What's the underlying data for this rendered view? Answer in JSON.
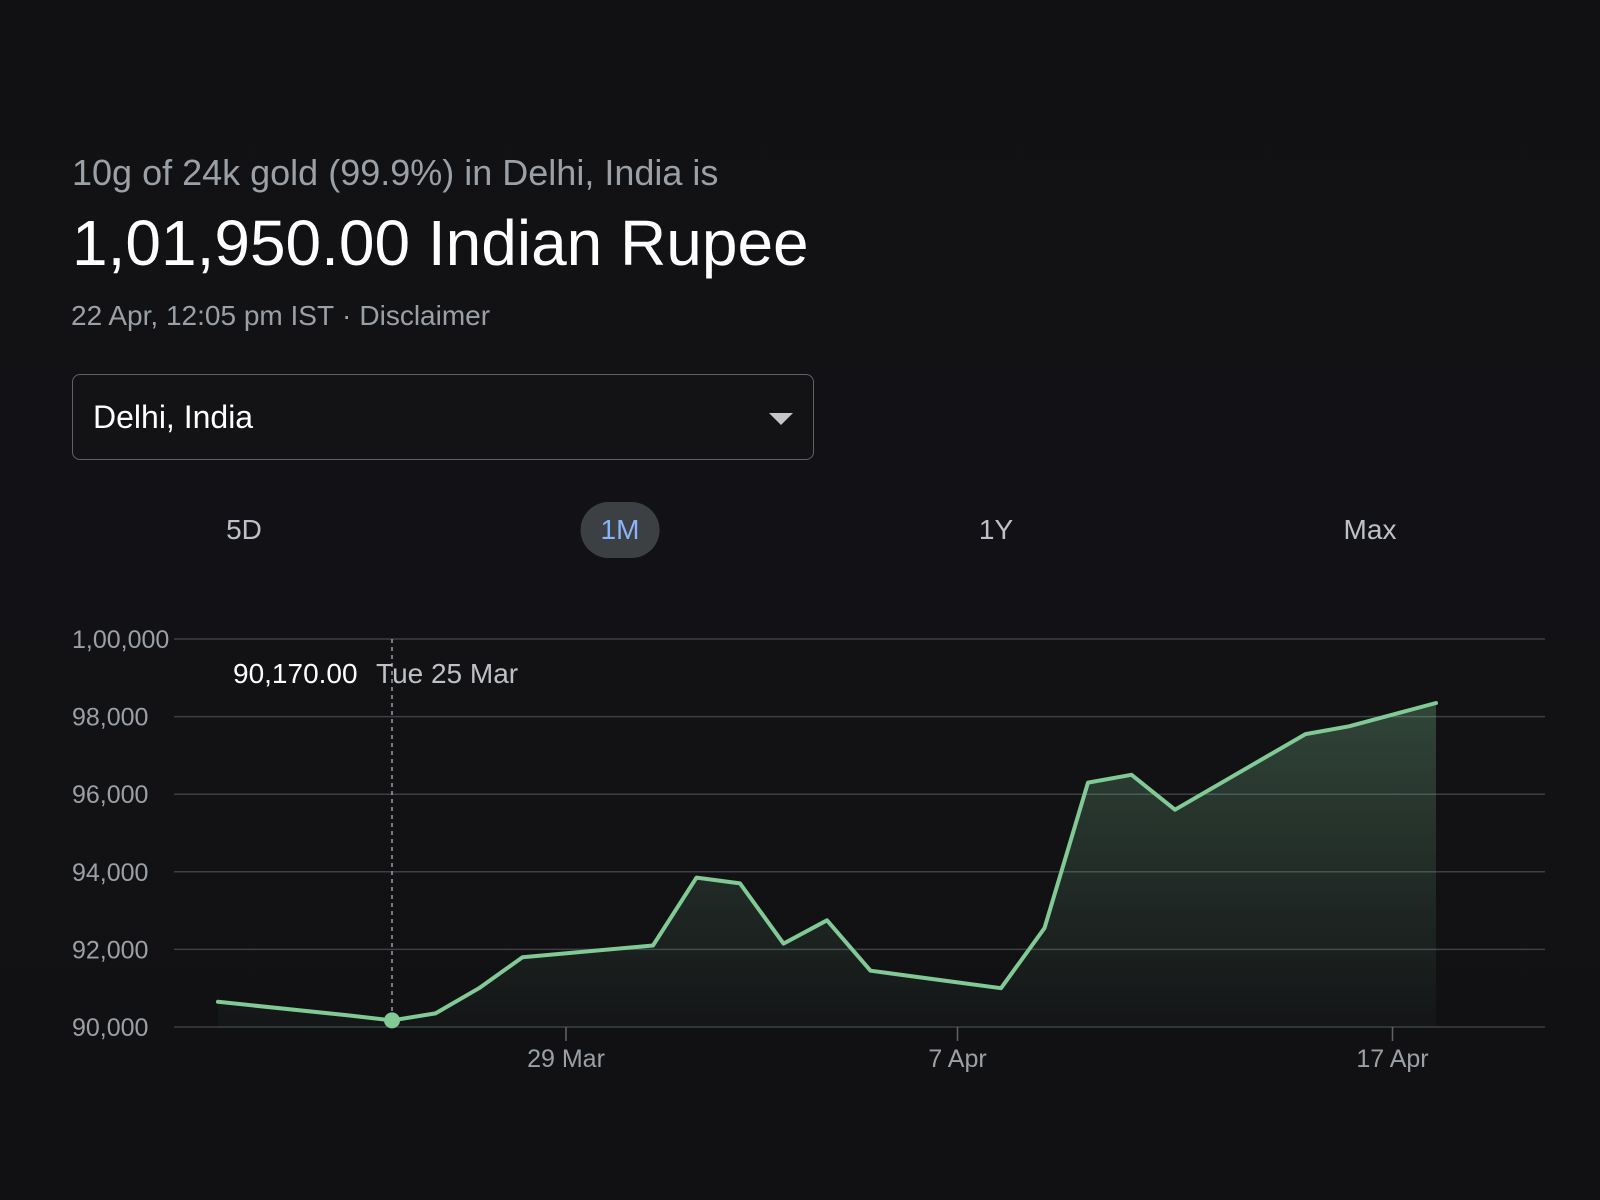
{
  "header": {
    "subtitle": "10g of 24k gold (99.9%) in Delhi, India is",
    "price": "1,01,950.00 Indian Rupee",
    "timestamp": "22 Apr, 12:05 pm IST",
    "separator": "·",
    "disclaimer": "Disclaimer"
  },
  "location_select": {
    "value": "Delhi, India",
    "icon": "chevron-down-icon"
  },
  "range_tabs": [
    {
      "label": "5D",
      "active": false
    },
    {
      "label": "1M",
      "active": true
    },
    {
      "label": "1Y",
      "active": false
    },
    {
      "label": "Max",
      "active": false
    }
  ],
  "tooltip": {
    "value": "90,170.00",
    "date": "Tue 25 Mar"
  },
  "colors": {
    "line": "#81c995",
    "active_tab_text": "#8ab4f8",
    "active_tab_bg": "#3c4043",
    "grid": "#3c4043"
  },
  "chart_data": {
    "type": "area",
    "title": "",
    "xlabel": "",
    "ylabel": "",
    "ylim": [
      90000,
      100000
    ],
    "y_ticks": [
      {
        "value": 100000,
        "label": "1,00,000"
      },
      {
        "value": 98000,
        "label": "98,000"
      },
      {
        "value": 96000,
        "label": "96,000"
      },
      {
        "value": 94000,
        "label": "94,000"
      },
      {
        "value": 92000,
        "label": "92,000"
      },
      {
        "value": 90000,
        "label": "90,000"
      }
    ],
    "x_ticks": [
      {
        "date": "2025-03-29",
        "label": "29 Mar"
      },
      {
        "date": "2025-04-07",
        "label": "7 Apr"
      },
      {
        "date": "2025-04-17",
        "label": "17 Apr"
      }
    ],
    "xlim": [
      "2025-03-21",
      "2025-04-20"
    ],
    "grid": true,
    "highlight": {
      "date": "2025-03-25",
      "value": 90170
    },
    "series": [
      {
        "points": [
          {
            "date": "2025-03-21",
            "value": 90650
          },
          {
            "date": "2025-03-24",
            "value": 90300
          },
          {
            "date": "2025-03-25",
            "value": 90170
          },
          {
            "date": "2025-03-26",
            "value": 90350
          },
          {
            "date": "2025-03-27",
            "value": 91000
          },
          {
            "date": "2025-03-28",
            "value": 91800
          },
          {
            "date": "2025-03-31",
            "value": 92100
          },
          {
            "date": "2025-04-01",
            "value": 93850
          },
          {
            "date": "2025-04-02",
            "value": 93700
          },
          {
            "date": "2025-04-03",
            "value": 92150
          },
          {
            "date": "2025-04-04",
            "value": 92750
          },
          {
            "date": "2025-04-05",
            "value": 91450
          },
          {
            "date": "2025-04-07",
            "value": 91150
          },
          {
            "date": "2025-04-08",
            "value": 91000
          },
          {
            "date": "2025-04-09",
            "value": 92550
          },
          {
            "date": "2025-04-10",
            "value": 96300
          },
          {
            "date": "2025-04-11",
            "value": 96500
          },
          {
            "date": "2025-04-12",
            "value": 95600
          },
          {
            "date": "2025-04-15",
            "value": 97550
          },
          {
            "date": "2025-04-16",
            "value": 97750
          },
          {
            "date": "2025-04-18",
            "value": 98350
          }
        ]
      }
    ]
  }
}
